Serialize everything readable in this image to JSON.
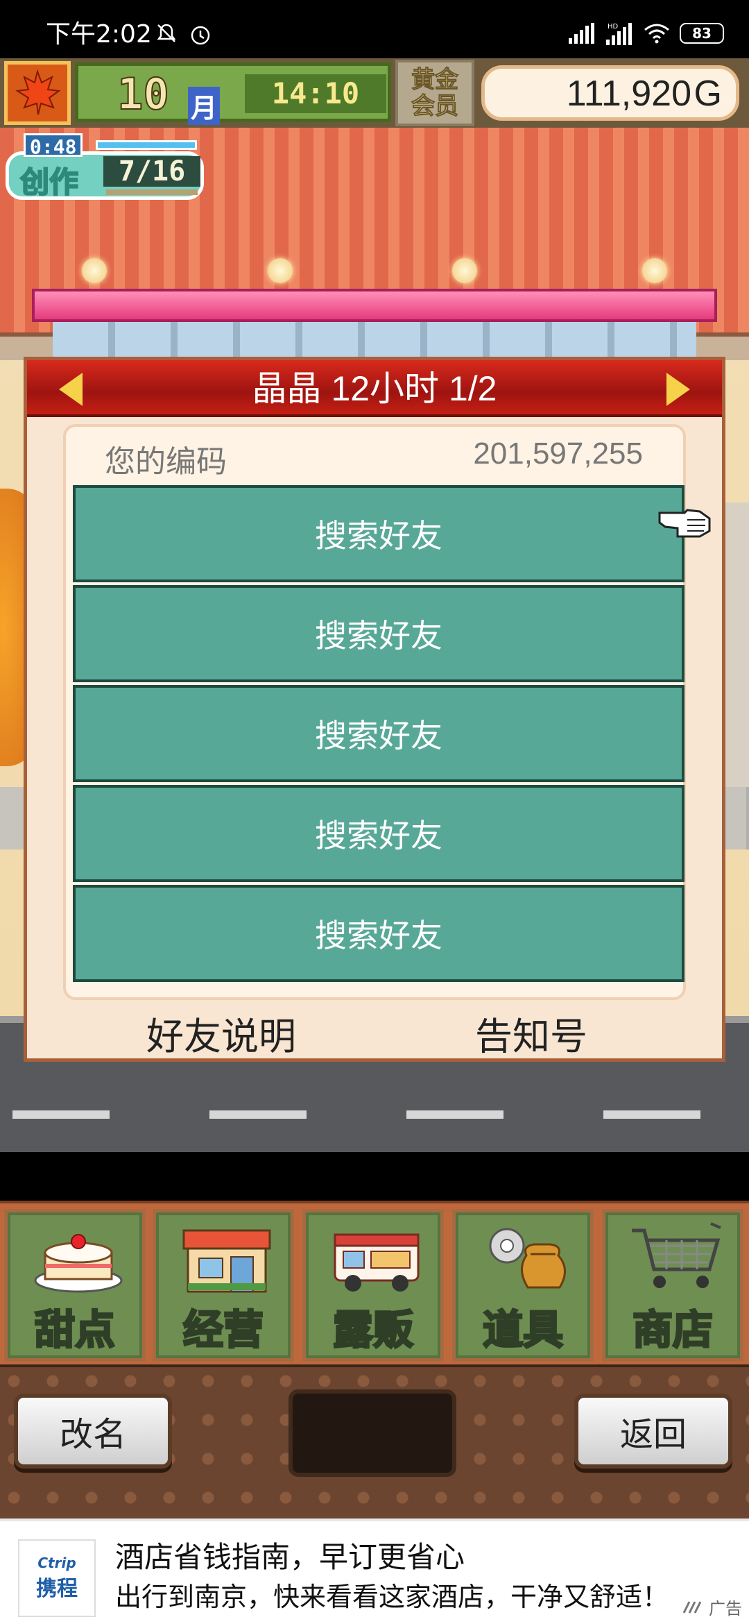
{
  "status_bar": {
    "time": "下午2:02",
    "battery": "83",
    "icons": [
      "bell-muted-icon",
      "alarm-icon",
      "signal-icon",
      "hd-signal-icon",
      "wifi-icon",
      "battery-icon"
    ]
  },
  "hud": {
    "season_icon": "maple-leaf-icon",
    "month": "10",
    "month_unit": "月",
    "clock": "14:10",
    "gold_member_line1": "黄金",
    "gold_member_line2": "会员",
    "money": "111,920",
    "money_unit": "G"
  },
  "craft": {
    "timer": "0:48",
    "label": "创作",
    "count": "7/16"
  },
  "dialog": {
    "title": "晶晶  12小时 1/2",
    "code_label": "您的编码",
    "code_value": "201,597,255",
    "friend_slots": [
      {
        "label": "搜索好友"
      },
      {
        "label": "搜索好友"
      },
      {
        "label": "搜索好友"
      },
      {
        "label": "搜索好友"
      },
      {
        "label": "搜索好友"
      }
    ],
    "footer_left": "好友说明",
    "footer_right": "告知号"
  },
  "menu": [
    {
      "label": "甜点",
      "icon": "cake-icon"
    },
    {
      "label": "经营",
      "icon": "shop-icon"
    },
    {
      "label": "露贩",
      "icon": "food-truck-icon"
    },
    {
      "label": "道具",
      "icon": "item-bag-icon"
    },
    {
      "label": "商店",
      "icon": "shopping-cart-icon"
    }
  ],
  "controls": {
    "rename": "改名",
    "back": "返回"
  },
  "ad": {
    "logo_en": "Ctrip",
    "logo_cn": "携程",
    "title": "酒店省钱指南，早订更省心",
    "description": "出行到南京，快来看看这家酒店，干净又舒适！",
    "tag": "广告"
  },
  "colors": {
    "dialog_header": "#b8180f",
    "friend_button": "#58a898",
    "menu_tile": "#6f8e52",
    "roof": "#e2684c"
  }
}
